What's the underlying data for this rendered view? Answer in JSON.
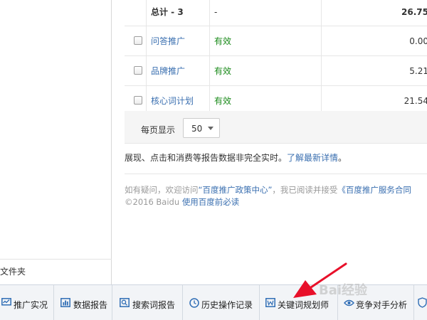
{
  "sidebar": {
    "folder_label": "文件夹"
  },
  "table": {
    "total": {
      "name": "总计 - 3",
      "status": "-",
      "value": "26.75"
    },
    "rows": [
      {
        "name": "问答推广",
        "status": "有效",
        "value": "0.00"
      },
      {
        "name": "品牌推广",
        "status": "有效",
        "value": "5.21"
      },
      {
        "name": "核心词计划",
        "status": "有效",
        "value": "21.54"
      }
    ]
  },
  "pager": {
    "label": "每页显示",
    "page_size": "50"
  },
  "notice": {
    "text": "展现、点击和消费等报告数据非完全实时。",
    "link": "了解最新详情",
    "suffix": "。"
  },
  "footer": {
    "line1_prefix": "如有疑问，欢迎访问",
    "line1_link1": "“百度推广政策中心”",
    "line1_middle": "，我已阅读并接受",
    "line1_link2": "《百度推广服务合同",
    "line2_prefix": "©2016 Baidu ",
    "line2_link": "使用百度前必读"
  },
  "toolbar": {
    "items": [
      {
        "label": "推广实况",
        "icon": "monitor-icon"
      },
      {
        "label": "数据报告",
        "icon": "bar-chart-icon"
      },
      {
        "label": "搜索词报告",
        "icon": "search-icon"
      },
      {
        "label": "历史操作记录",
        "icon": "clock-icon"
      },
      {
        "label": "关键词规划师",
        "icon": "keyword-icon"
      },
      {
        "label": "竞争对手分析",
        "icon": "eye-icon"
      }
    ]
  },
  "watermark": "Bai经验",
  "colors": {
    "link": "#3a6fb0",
    "status_valid": "#1a8a1a",
    "annotation_arrow": "#e8102a"
  }
}
